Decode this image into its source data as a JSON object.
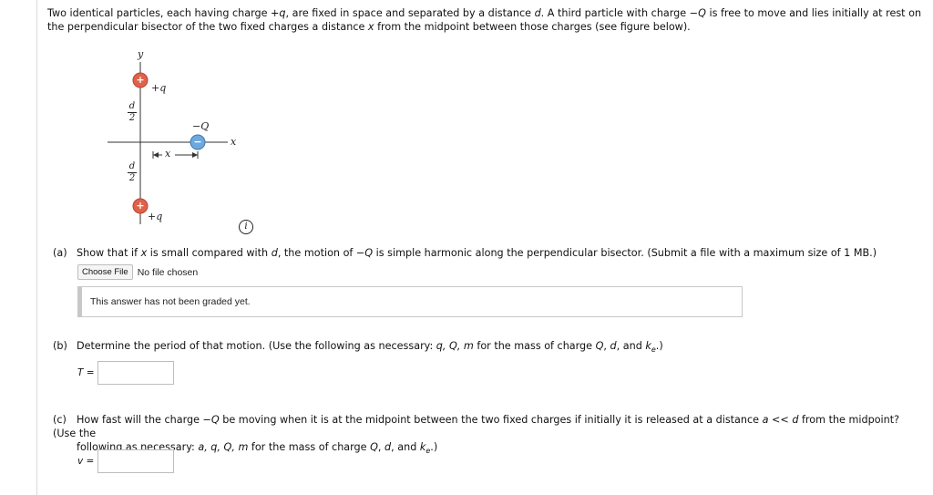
{
  "intro": {
    "text_part1": "Two identical particles, each having charge +",
    "q": "q",
    "text_part2": ", are fixed in space and separated by a distance ",
    "d": "d",
    "text_part3": ". A third particle with charge −",
    "Q": "Q",
    "text_part4": " is free to move and lies initially at rest on the perpendicular bisector of the two fixed charges a distance ",
    "x": "x",
    "text_part5": " from the midpoint between those charges (see figure below)."
  },
  "figure": {
    "y_label": "y",
    "x_label": "x",
    "top_charge_label": "+q",
    "bottom_charge_label": "+q",
    "moving_charge_label": "−Q",
    "distance_label": "x",
    "half_d_num": "d",
    "half_d_den": "2",
    "plus_symbol": "+",
    "minus_symbol": "−",
    "info_symbol": "i",
    "colors": {
      "positive": "#e0624a",
      "negative": "#6fa8dc",
      "line": "#333333"
    }
  },
  "part_a": {
    "tag": "(a)",
    "text1": "Show that if ",
    "x": "x",
    "text2": " is small compared with ",
    "d": "d",
    "text3": ", the motion of −",
    "Q": "Q",
    "text4": " is simple harmonic along the perpendicular bisector. (Submit a file with a maximum size of 1 MB.)",
    "choose_file_label": "Choose File",
    "no_file_text": "No file chosen",
    "graded_text": "This answer has not been graded yet."
  },
  "part_b": {
    "tag": "(b)",
    "text1": "Determine the period of that motion. (Use the following as necessary: ",
    "vars": "q, Q, m",
    "text2": " for the mass of charge ",
    "Q": "Q",
    "d": "d",
    "and_text": ", and ",
    "k": "k",
    "k_sub": "e",
    "end_text": ".)",
    "answer_label": "T =",
    "answer_value": ""
  },
  "part_c": {
    "tag": "(c)",
    "text1": "How fast will the charge −",
    "Q": "Q",
    "text2": " be moving when it is at the midpoint between the two fixed charges if initially it is released at a distance ",
    "a": "a",
    "text3": " << ",
    "d": "d",
    "text4": " from the midpoint? (Use the",
    "line2_text1": "following as necessary: ",
    "vars": "a, q, Q, m",
    "line2_text2": " for the mass of charge ",
    "and_text": ", and ",
    "k": "k",
    "k_sub": "e",
    "end_text": ".)",
    "answer_label": "v =",
    "answer_value": ""
  }
}
